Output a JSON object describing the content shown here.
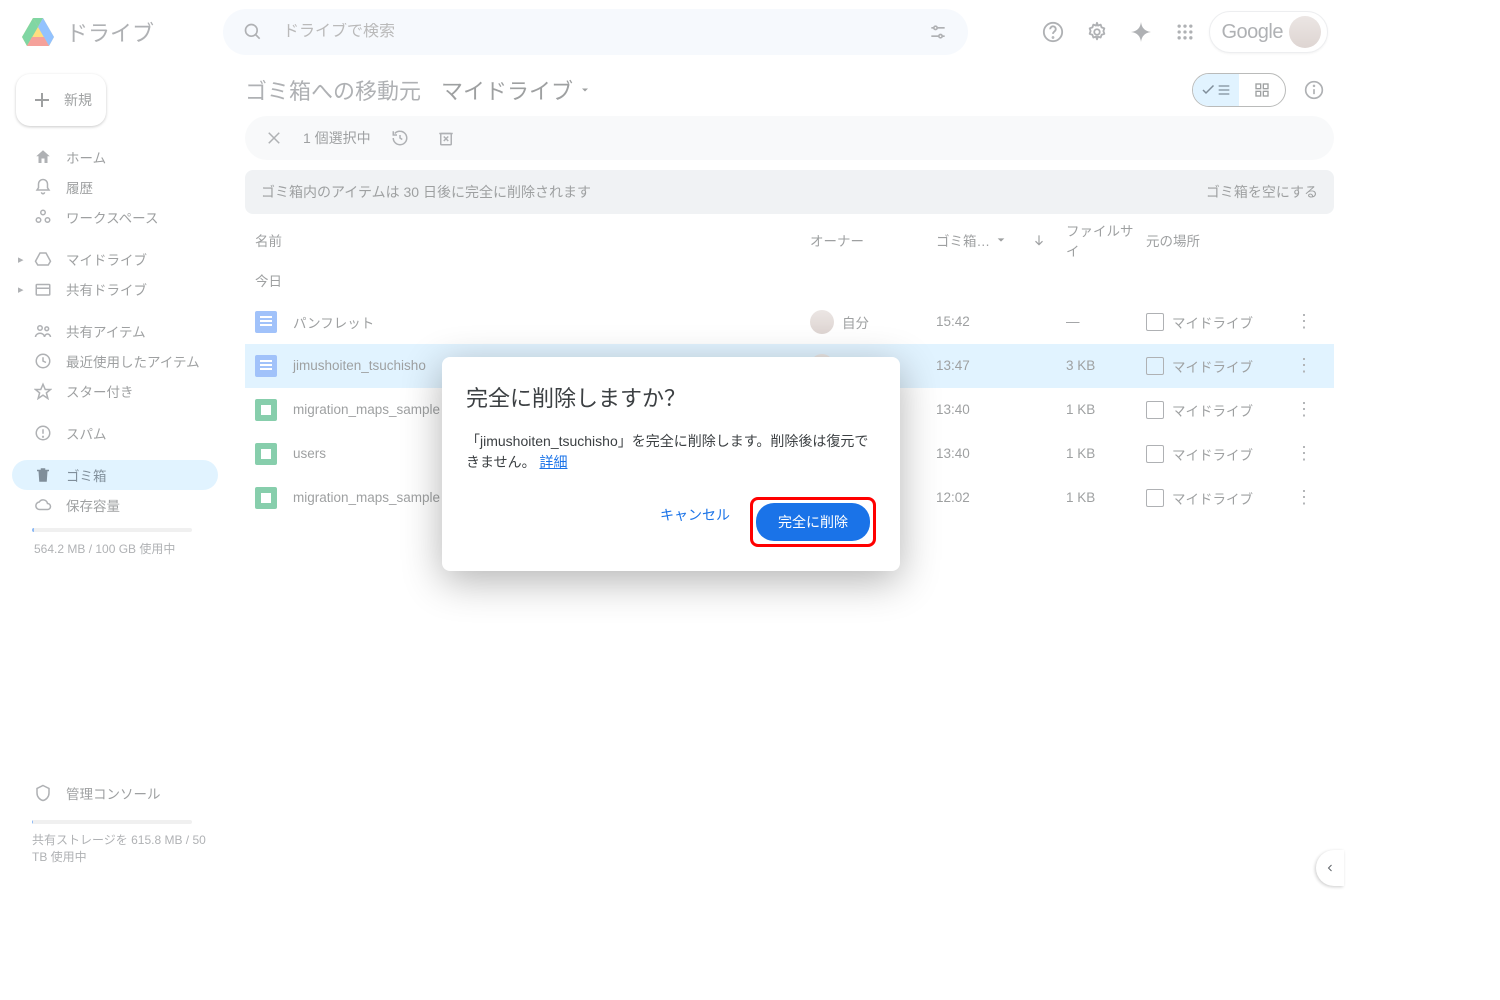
{
  "header": {
    "product_name": "ドライブ",
    "search_placeholder": "ドライブで検索",
    "google_label": "Google"
  },
  "sidebar": {
    "new_label": "新規",
    "items": [
      {
        "label": "ホーム",
        "icon": "home"
      },
      {
        "label": "履歴",
        "icon": "bell"
      },
      {
        "label": "ワークスペース",
        "icon": "workspaces"
      },
      {
        "label": "マイドライブ",
        "icon": "mydrive",
        "expandable": true
      },
      {
        "label": "共有ドライブ",
        "icon": "shared-drive",
        "expandable": true
      },
      {
        "label": "共有アイテム",
        "icon": "people"
      },
      {
        "label": "最近使用したアイテム",
        "icon": "clock"
      },
      {
        "label": "スター付き",
        "icon": "star"
      },
      {
        "label": "スパム",
        "icon": "spam"
      },
      {
        "label": "ゴミ箱",
        "icon": "trash",
        "active": true
      },
      {
        "label": "保存容量",
        "icon": "cloud"
      }
    ],
    "storage_text": "564.2 MB / 100 GB 使用中",
    "storage_pct": 1,
    "admin_label": "管理コンソール",
    "shared_storage_text": "共有ストレージを 615.8 MB / 50 TB 使用中",
    "shared_pct": 0.1
  },
  "crumbs": {
    "prefix": "ゴミ箱への移動元",
    "current": "マイドライブ"
  },
  "selection": {
    "count_text": "1 個選択中"
  },
  "banner": {
    "text": "ゴミ箱内のアイテムは 30 日後に完全に削除されます",
    "action": "ゴミ箱を空にする"
  },
  "columns": {
    "name": "名前",
    "owner": "オーナー",
    "trashed": "ゴミ箱…",
    "size": "ファイルサイ",
    "location": "元の場所"
  },
  "section_today": "今日",
  "owner_self": "自分",
  "location_mydrive": "マイドライブ",
  "rows": [
    {
      "name": "パンフレット",
      "type": "docs",
      "time": "15:42",
      "size": "—",
      "selected": false
    },
    {
      "name": "jimushoiten_tsuchisho",
      "type": "docs",
      "time": "13:47",
      "size": "3 KB",
      "selected": true
    },
    {
      "name": "migration_maps_sample",
      "type": "sheets",
      "time": "13:40",
      "size": "1 KB",
      "selected": false
    },
    {
      "name": "users",
      "type": "sheets",
      "time": "13:40",
      "size": "1 KB",
      "selected": false
    },
    {
      "name": "migration_maps_sample",
      "type": "sheets",
      "time": "12:02",
      "size": "1 KB",
      "selected": false
    }
  ],
  "dialog": {
    "title": "完全に削除しますか？",
    "body": "「jimushoiten_tsuchisho」を完全に削除します。削除後は復元できません。",
    "details": "詳細",
    "cancel": "キャンセル",
    "confirm": "完全に削除"
  }
}
